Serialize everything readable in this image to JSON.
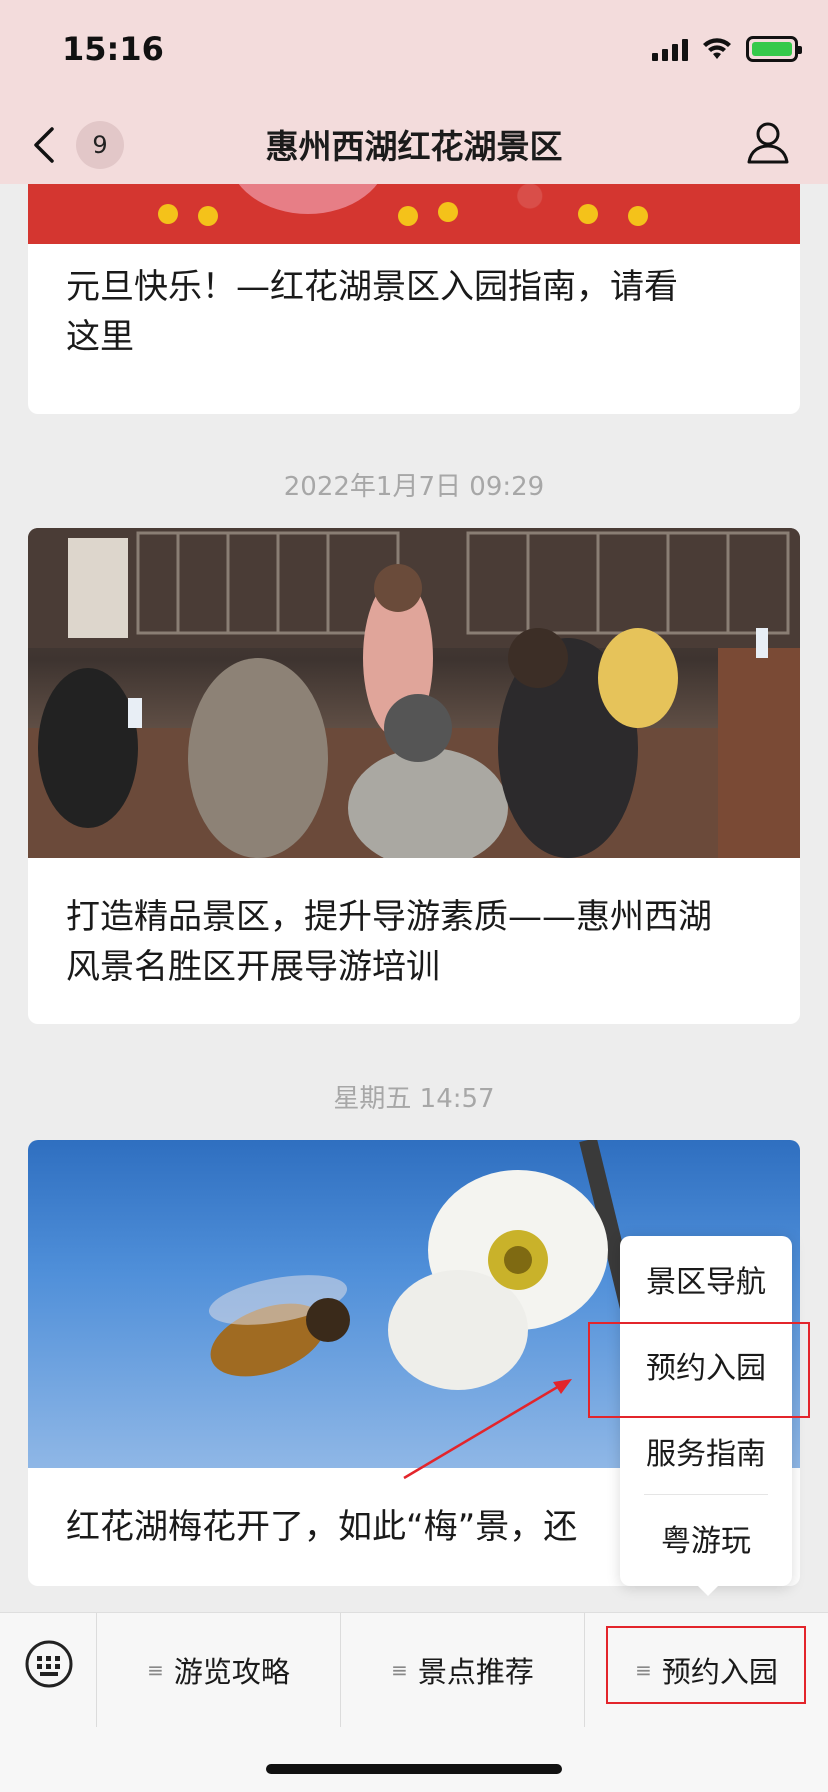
{
  "status_bar": {
    "time": "15:16"
  },
  "nav": {
    "back_count": "9",
    "title": "惠州西湖红花湖景区"
  },
  "articles": [
    {
      "title_line1": "元旦快乐！—红花湖景区入园指南，请看",
      "title_line2": "这里"
    },
    {
      "timestamp": "2022年1月7日 09:29",
      "title_line1": "打造精品景区，提升导游素质——惠州西湖",
      "title_line2": "风景名胜区开展导游培训"
    },
    {
      "timestamp": "星期五 14:57",
      "title_line1": "红花湖梅花开了，如此“梅”景，还"
    }
  ],
  "popup_menu": {
    "items": [
      "景区导航",
      "预约入园",
      "服务指南",
      "粤游玩"
    ]
  },
  "bottom_menu": {
    "items": [
      "游览攻略",
      "景点推荐",
      "预约入园"
    ]
  },
  "colors": {
    "annotation": "#e3252b",
    "header_bg": "#f3dcdc",
    "battery": "#35c94a"
  }
}
